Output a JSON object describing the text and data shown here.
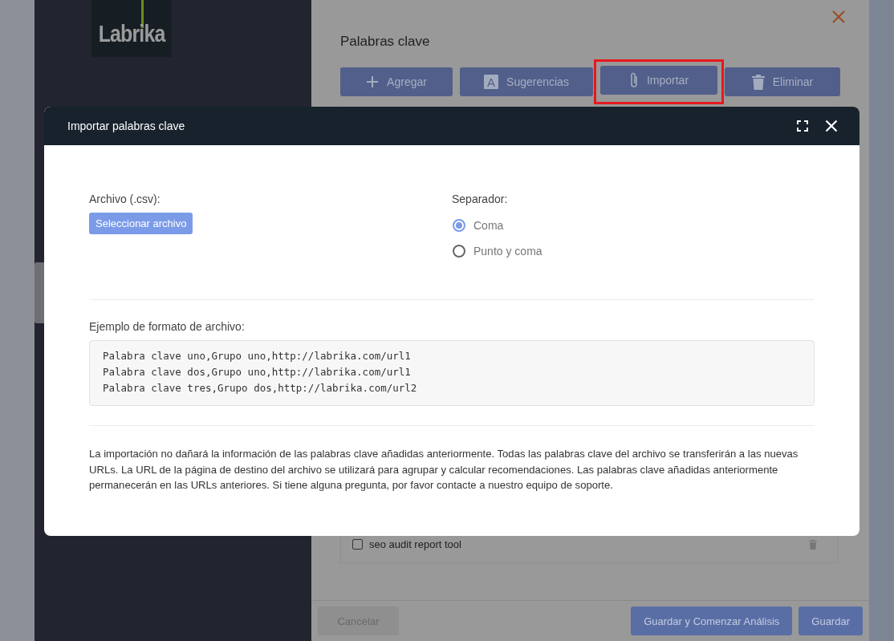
{
  "app": {
    "logo": "Labrika"
  },
  "section": {
    "title": "Palabras clave",
    "toolbar": [
      {
        "label": "Agregar",
        "kind": "plus",
        "highlighted": false
      },
      {
        "label": "Sugerencias",
        "kind": "letter",
        "glyph": "A",
        "highlighted": false
      },
      {
        "label": "Importar",
        "kind": "paperclip",
        "highlighted": true
      },
      {
        "label": "Eliminar",
        "kind": "trash",
        "highlighted": false
      }
    ]
  },
  "keywords": [
    {
      "text": "seo audit report tool",
      "checked": false
    }
  ],
  "footer": {
    "buttons": [
      {
        "label": "Cancelar",
        "kind": "secondary"
      },
      {
        "label": "Guardar y Comenzar Análisis",
        "kind": "primary"
      },
      {
        "label": "Guardar",
        "kind": "primary"
      }
    ]
  },
  "dialog": {
    "title": "Importar palabras clave",
    "file_label": "Archivo (.csv):",
    "file_button": "Seleccionar archivo",
    "separator_label": "Separador:",
    "separators": [
      {
        "label": "Coma",
        "selected": true
      },
      {
        "label": "Punto y coma",
        "selected": false
      }
    ],
    "example_label": "Ejemplo de formato de archivo:",
    "example_lines": [
      "Palabra clave uno,Grupo uno,http://labrika.com/url1",
      "Palabra clave dos,Grupo uno,http://labrika.com/url1",
      "Palabra clave tres,Grupo dos,http://labrika.com/url2"
    ],
    "note": "La importación no dañará la información de las palabras clave añadidas anteriormente. Todas las palabras clave del archivo se transferirán a las nuevas URLs. La URL de la página de destino del archivo se utilizará para agrupar y calcular recomendaciones. Las palabras clave añadidas anteriormente permanecerán en las URLs anteriores. Si tiene alguna pregunta, por favor contacte a nuestro equipo de soporte."
  }
}
